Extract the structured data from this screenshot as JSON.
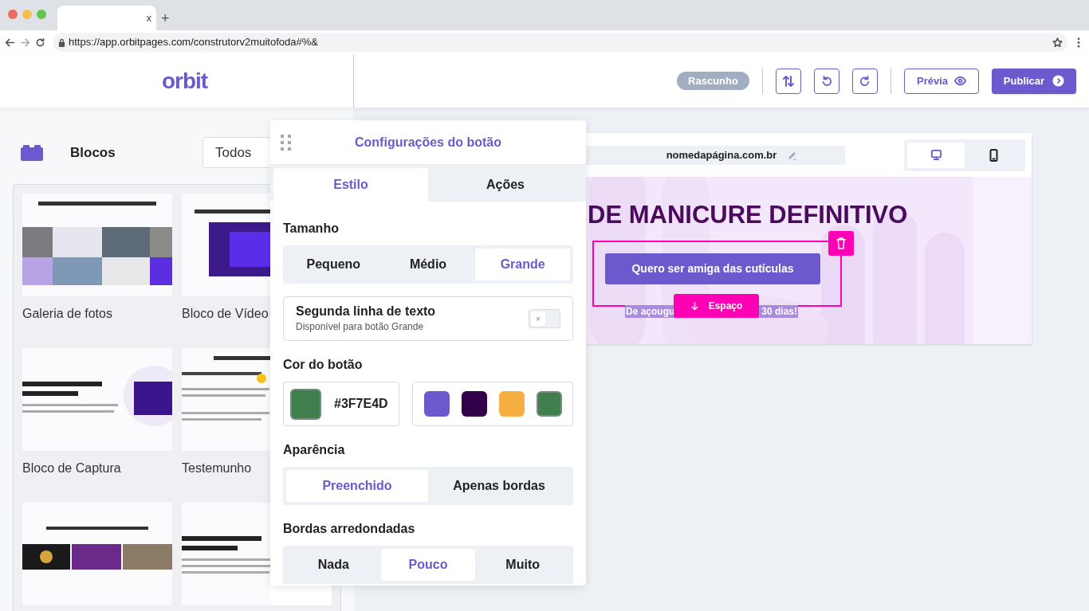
{
  "browser": {
    "tab_close": "x",
    "new_tab": "+",
    "url": "https://app.orbitpages.com/construtorv2muitofoda#%&"
  },
  "header": {
    "logo": "orbit",
    "status": "Rascunho",
    "preview": "Prévia",
    "publish": "Publicar"
  },
  "blocks_panel": {
    "title": "Blocos",
    "filter": "Todos",
    "blocks": [
      {
        "kind": "picture",
        "label": "Galeria de fotos"
      },
      {
        "kind": "picture",
        "label": "Bloco de Vídeo"
      },
      {
        "kind": "picture",
        "label": "Bloco de Captura"
      },
      {
        "kind": "picture",
        "label": "Testemunho"
      },
      {
        "kind": "picture"
      },
      {
        "kind": "picture"
      }
    ]
  },
  "settings_panel": {
    "title": "Configurações do botão",
    "tabs": [
      {
        "label": "Estilo",
        "selected": true
      },
      {
        "label": "Ações",
        "selected": false
      }
    ],
    "size": {
      "label": "Tamanho",
      "options": [
        {
          "label": "Pequeno",
          "selected": false
        },
        {
          "label": "Médio",
          "selected": false
        },
        {
          "label": "Grande",
          "selected": true
        }
      ]
    },
    "second_line": {
      "title": "Segunda linha de texto",
      "subtitle": "Disponível para botão Grande",
      "on": false,
      "toggle_mark": "×"
    },
    "button_color": {
      "label": "Cor do botão",
      "hex": "#3F7E4D",
      "swatches": [
        {
          "color": "#6a5acd",
          "selected": false
        },
        {
          "color": "#33004a",
          "selected": false
        },
        {
          "color": "#f5b041",
          "selected": false
        },
        {
          "color": "#3f7e4d",
          "selected": true
        }
      ]
    },
    "appearance": {
      "label": "Aparência",
      "options": [
        {
          "label": "Preenchido",
          "selected": true
        },
        {
          "label": "Apenas bordas",
          "selected": false
        }
      ]
    },
    "corners": {
      "label": "Bordas arredondadas",
      "options": [
        {
          "label": "Nada",
          "selected": false
        },
        {
          "label": "Pouco",
          "selected": true
        },
        {
          "label": "Muito",
          "selected": false
        }
      ]
    }
  },
  "preview": {
    "url": "nomedapágina.com.br",
    "devices": [
      {
        "kind": "desktop",
        "selected": true
      },
      {
        "kind": "mobile",
        "selected": false
      }
    ],
    "headline": "DE MANICURE DEFINITIVO",
    "cta": "Quero ser amiga das cutículas",
    "subtitle_parts": [
      "De açougu",
      "30 dias!"
    ],
    "spacing_button": "Espaço"
  }
}
